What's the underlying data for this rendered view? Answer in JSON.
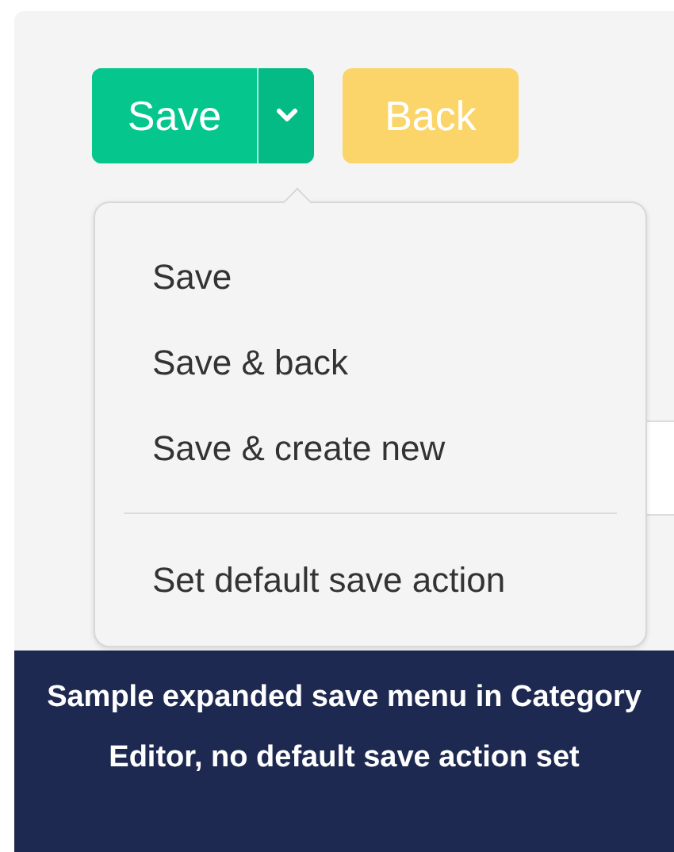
{
  "toolbar": {
    "save_button": {
      "label": "Save"
    },
    "back_button": {
      "label": "Back"
    }
  },
  "save_menu": {
    "expanded": true,
    "items": [
      {
        "label": "Save",
        "kind": "action"
      },
      {
        "label": "Save & back",
        "kind": "action"
      },
      {
        "label": "Save & create new",
        "kind": "action"
      },
      {
        "kind": "divider"
      },
      {
        "label": "Set default save action",
        "kind": "action"
      }
    ]
  },
  "caption": "Sample expanded save menu in Category Editor, no default save action set"
}
